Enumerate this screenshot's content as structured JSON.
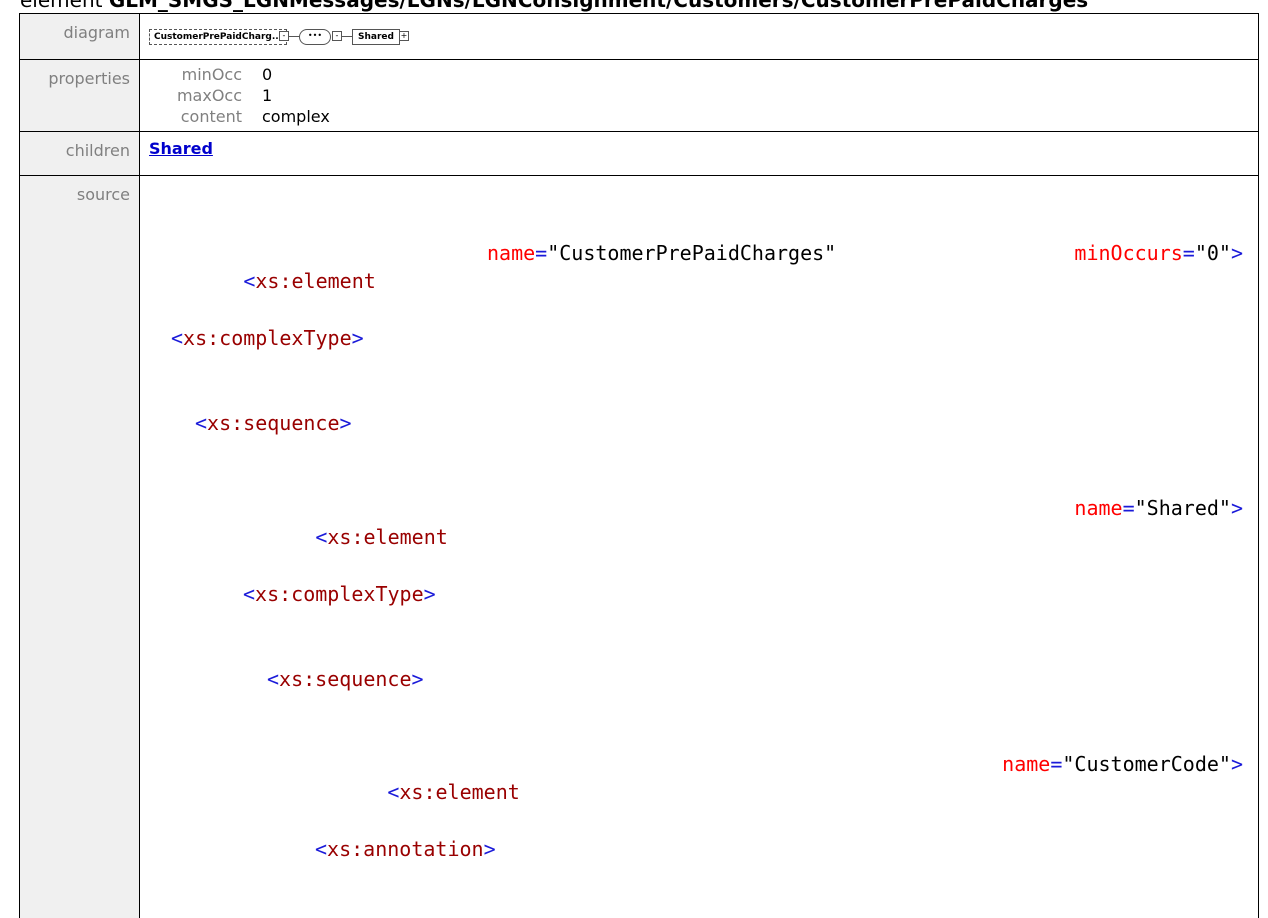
{
  "title": {
    "prefix": "element",
    "path": "GLM_SMGS_LGNMessages/LGNs/LGNConsignment/Customers/CustomerPrePaidCharges"
  },
  "rows": {
    "diagram_label": "diagram",
    "properties_label": "properties",
    "children_label": "children",
    "source_label": "source"
  },
  "diagram": {
    "node_label": "CustomerPrePaidCharg...",
    "sequence_symbol": "•••",
    "child_label": "Shared"
  },
  "properties": [
    {
      "key": "minOcc",
      "value": "0"
    },
    {
      "key": "maxOcc",
      "value": "1"
    },
    {
      "key": "content",
      "value": "complex"
    }
  ],
  "children": {
    "link": "Shared"
  },
  "source": {
    "l1": {
      "open": "<",
      "tag": "xs:element",
      "attr": "name",
      "eq": "=",
      "val": "\"CustomerPrePaidCharges\"",
      "attr2": "minOccurs",
      "val2": "\"0\"",
      "close": ">"
    },
    "l2": {
      "open": "<",
      "tag": "xs:complexType",
      "close": ">"
    },
    "l3": {
      "open": "<",
      "tag": "xs:sequence",
      "close": ">"
    },
    "l4": {
      "open": "<",
      "tag": "xs:element",
      "attr": "name",
      "eq": "=",
      "val": "\"Shared\"",
      "close": ">"
    },
    "l5": {
      "open": "<",
      "tag": "xs:complexType",
      "close": ">"
    },
    "l6": {
      "open": "<",
      "tag": "xs:sequence",
      "close": ">"
    },
    "l7": {
      "open": "<",
      "tag": "xs:element",
      "attr": "name",
      "eq": "=",
      "val": "\"CustomerCode\"",
      "close": ">"
    },
    "l8": {
      "open": "<",
      "tag": "xs:annotation",
      "close": ">"
    }
  }
}
